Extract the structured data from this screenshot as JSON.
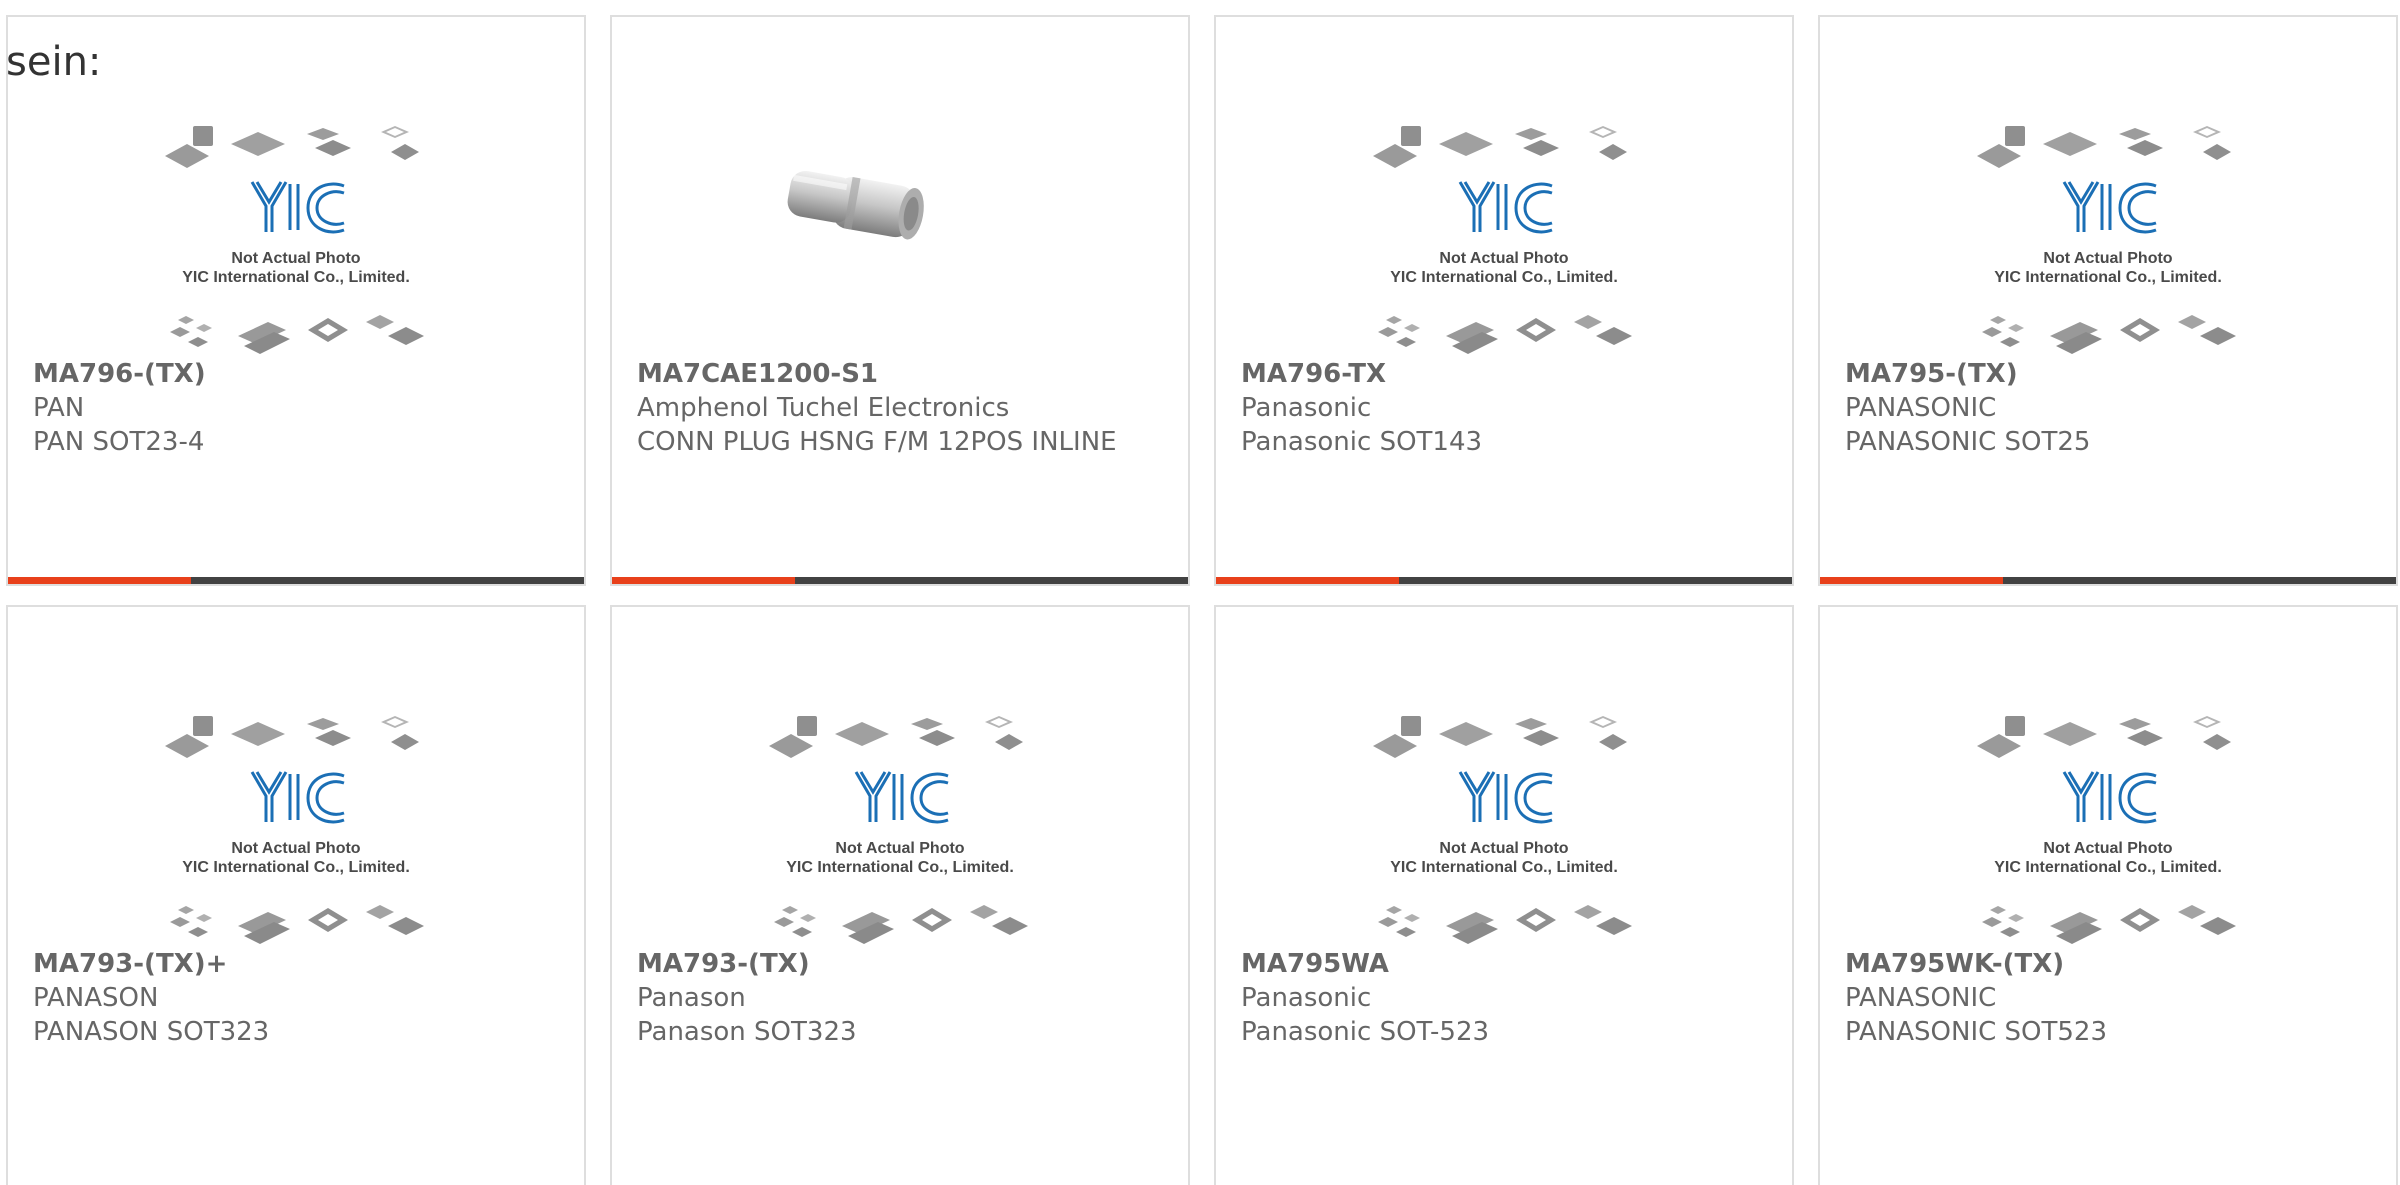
{
  "intro_text": "sein:",
  "placeholder": {
    "line1": "Not Actual Photo",
    "line2": "YIC International Co., Limited.",
    "logo_text": "YIC"
  },
  "colors": {
    "accent": "#e8401b",
    "bar": "#424242",
    "logo": "#1b6fb5"
  },
  "products": [
    {
      "part_number": "MA796-(TX)",
      "manufacturer": "PAN",
      "description": "PAN SOT23-4",
      "image": "yic-placeholder"
    },
    {
      "part_number": "MA7CAE1200-S1",
      "manufacturer": "Amphenol Tuchel Electronics",
      "description": "CONN PLUG HSNG F/M 12POS INLINE",
      "image": "connector-photo"
    },
    {
      "part_number": "MA796-TX",
      "manufacturer": "Panasonic",
      "description": "Panasonic SOT143",
      "image": "yic-placeholder"
    },
    {
      "part_number": "MA795-(TX)",
      "manufacturer": "PANASONIC",
      "description": "PANASONIC SOT25",
      "image": "yic-placeholder"
    },
    {
      "part_number": "MA793-(TX)+",
      "manufacturer": "PANASON",
      "description": "PANASON SOT323",
      "image": "yic-placeholder"
    },
    {
      "part_number": "MA793-(TX)",
      "manufacturer": "Panason",
      "description": "Panason SOT323",
      "image": "yic-placeholder"
    },
    {
      "part_number": "MA795WA",
      "manufacturer": "Panasonic",
      "description": "Panasonic SOT-523",
      "image": "yic-placeholder"
    },
    {
      "part_number": "MA795WK-(TX)",
      "manufacturer": "PANASONIC",
      "description": "PANASONIC SOT523",
      "image": "yic-placeholder"
    }
  ]
}
